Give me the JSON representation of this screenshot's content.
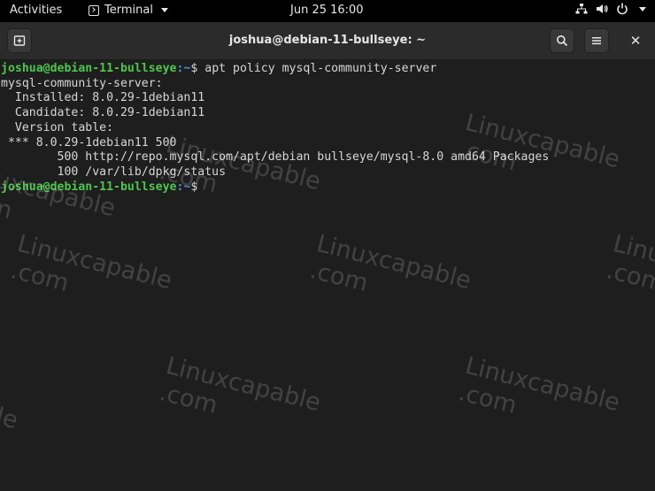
{
  "topbar": {
    "activities": "Activities",
    "app_name": "Terminal",
    "clock": "Jun 25  16:00"
  },
  "window": {
    "title": "joshua@debian-11-bullseye: ~"
  },
  "terminal": {
    "prompt_user_host": "joshua@debian-11-bullseye",
    "prompt_path": ":~",
    "command": "$ apt policy mysql-community-server",
    "output_lines": [
      "mysql-community-server:",
      "  Installed: 8.0.29-1debian11",
      "  Candidate: 8.0.29-1debian11",
      "  Version table:",
      " *** 8.0.29-1debian11 500",
      "        500 http://repo.mysql.com/apt/debian bullseye/mysql-8.0 amd64 Packages",
      "        100 /var/lib/dpkg/status"
    ],
    "final_prompt_suffix": "$"
  },
  "watermark": {
    "text_line1": "Linuxcapable",
    "text_line2": ".com"
  },
  "icons": [
    "new-tab-icon",
    "search-icon",
    "hamburger-menu-icon",
    "close-icon",
    "network-icon",
    "volume-icon",
    "power-icon",
    "terminal-app-icon"
  ]
}
